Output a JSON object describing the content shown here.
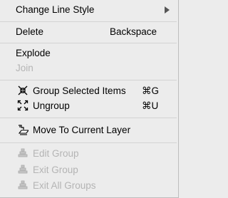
{
  "menu": {
    "change_line_style": "Change Line Style",
    "delete": {
      "label": "Delete",
      "shortcut": "Backspace"
    },
    "explode": "Explode",
    "join": "Join",
    "group_selected": {
      "label": "Group Selected Items",
      "shortcut": "⌘G"
    },
    "ungroup": {
      "label": "Ungroup",
      "shortcut": "⌘U"
    },
    "move_to_layer": "Move To Current Layer",
    "edit_group": "Edit Group",
    "exit_group": "Exit Group",
    "exit_all_groups": "Exit All Groups"
  },
  "icons": {
    "group": "group-icon",
    "ungroup": "ungroup-icon",
    "move_layer": "move-to-layer-icon",
    "edit_group": "edit-group-icon",
    "exit_group": "exit-group-icon",
    "exit_all_groups": "exit-all-groups-icon"
  },
  "colors": {
    "background": "#ececec",
    "disabled_text": "#b4b4b4",
    "separator": "#d3d3d3"
  }
}
